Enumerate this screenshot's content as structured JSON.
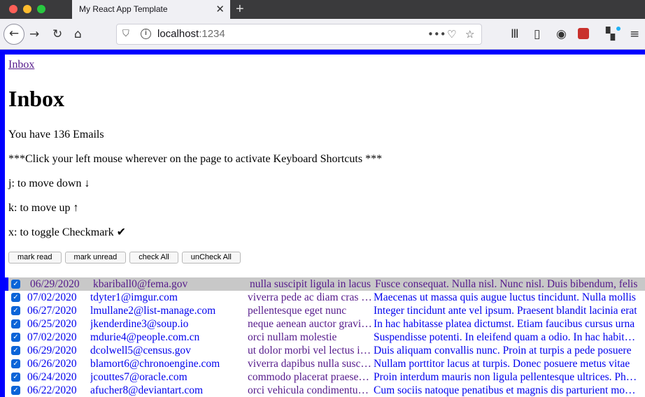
{
  "browser": {
    "tab_title": "My React App Template",
    "url_host": "localhost",
    "url_port": ":1234"
  },
  "page": {
    "breadcrumb": "Inbox",
    "title": "Inbox",
    "email_count_text": "You have 136 Emails",
    "instructions": "***Click your left mouse wherever on the page to activate Keyboard Shortcuts ***",
    "shortcut_down": "j: to move down ↓",
    "shortcut_up": "k: to move up ↑",
    "shortcut_toggle": "x: to toggle Checkmark ✔"
  },
  "toolbar": {
    "mark_read": "mark read",
    "mark_unread": "mark unread",
    "check_all": "check All",
    "uncheck_all": "unCheck All"
  },
  "emails": [
    {
      "date": "06/29/2020",
      "email": "kbariball0@fema.gov",
      "subject": "nulla suscipit ligula in lacus",
      "body": "Fusce consequat. Nulla nisl. Nunc nisl. Duis bibendum, felis",
      "checked": true,
      "selected": true
    },
    {
      "date": "07/02/2020",
      "email": "tdyter1@imgur.com",
      "subject": "viverra pede ac diam cras pellentesque",
      "body": "Maecenas ut massa quis augue luctus tincidunt. Nulla mollis",
      "checked": true,
      "selected": false
    },
    {
      "date": "06/27/2020",
      "email": "lmullane2@list-manage.com",
      "subject": "pellentesque eget nunc",
      "body": "Integer tincidunt ante vel ipsum. Praesent blandit lacinia erat",
      "checked": true,
      "selected": false
    },
    {
      "date": "06/25/2020",
      "email": "jkenderdine3@soup.io",
      "subject": "neque aenean auctor gravida sem",
      "body": "In hac habitasse platea dictumst. Etiam faucibus cursus urna",
      "checked": true,
      "selected": false
    },
    {
      "date": "07/02/2020",
      "email": "mdurie4@people.com.cn",
      "subject": "orci nullam molestie",
      "body": "Suspendisse potenti. In eleifend quam a odio. In hac habitasse",
      "checked": true,
      "selected": false
    },
    {
      "date": "06/29/2020",
      "email": "dcolwell5@census.gov",
      "subject": "ut dolor morbi vel lectus in quam",
      "body": "Duis aliquam convallis nunc. Proin at turpis a pede posuere",
      "checked": true,
      "selected": false
    },
    {
      "date": "06/26/2020",
      "email": "blamort6@chronoengine.com",
      "subject": "viverra dapibus nulla suscipit ligula",
      "body": "Nullam porttitor lacus at turpis. Donec posuere metus vitae",
      "checked": true,
      "selected": false
    },
    {
      "date": "06/24/2020",
      "email": "jcouttes7@oracle.com",
      "subject": "commodo placerat praesent blandit",
      "body": "Proin interdum mauris non ligula pellentesque ultrices. Phasellus",
      "checked": true,
      "selected": false
    },
    {
      "date": "06/22/2020",
      "email": "afucher8@deviantart.com",
      "subject": "orci vehicula condimentum curabitur",
      "body": "Cum sociis natoque penatibus et magnis dis parturient montes",
      "checked": true,
      "selected": false
    }
  ]
}
